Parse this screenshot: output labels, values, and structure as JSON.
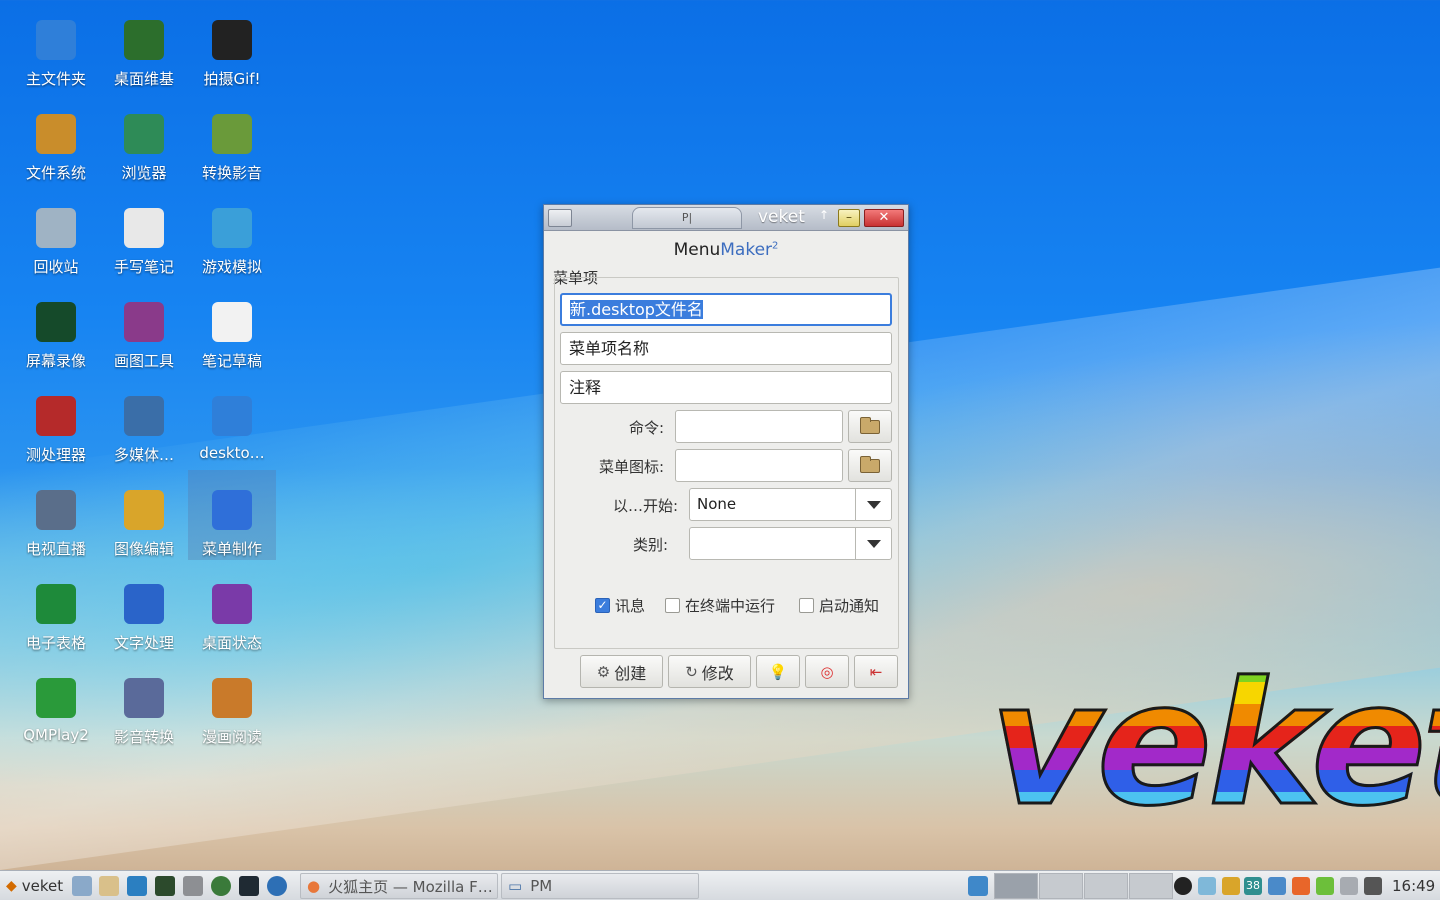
{
  "desktop": {
    "icons": [
      {
        "label": "主文件夹",
        "icon": "home-folder-icon"
      },
      {
        "label": "桌面维基",
        "icon": "wiki-icon"
      },
      {
        "label": "拍摄Gif!",
        "icon": "camera-icon"
      },
      {
        "label": "文件系统",
        "icon": "filesystem-icon"
      },
      {
        "label": "浏览器",
        "icon": "globe-icon"
      },
      {
        "label": "转换影音",
        "icon": "convert-media-icon"
      },
      {
        "label": "回收站",
        "icon": "trash-icon"
      },
      {
        "label": "手写笔记",
        "icon": "handwriting-icon"
      },
      {
        "label": "游戏模拟",
        "icon": "dolphin-icon"
      },
      {
        "label": "屏幕录像",
        "icon": "screen-record-icon"
      },
      {
        "label": "画图工具",
        "icon": "paint-icon"
      },
      {
        "label": "笔记草稿",
        "icon": "xournal-icon"
      },
      {
        "label": "测处理器",
        "icon": "cpu-test-icon"
      },
      {
        "label": "多媒体…",
        "icon": "multimedia-icon"
      },
      {
        "label": "deskto…",
        "icon": "folder-icon"
      },
      {
        "label": "电视直播",
        "icon": "tv-icon"
      },
      {
        "label": "图像编辑",
        "icon": "image-edit-icon"
      },
      {
        "label": "菜单制作",
        "icon": "translate-icon"
      },
      {
        "label": "电子表格",
        "icon": "spreadsheet-icon"
      },
      {
        "label": "文字处理",
        "icon": "word-icon"
      },
      {
        "label": "桌面状态",
        "icon": "monitor-icon"
      },
      {
        "label": "QMPlay2",
        "icon": "play-icon"
      },
      {
        "label": "影音转换",
        "icon": "video-convert-icon"
      },
      {
        "label": "漫画阅读",
        "icon": "monkey-icon"
      }
    ],
    "logo_text": "veket"
  },
  "window": {
    "title": "veket",
    "tab_text": "P|",
    "app_name_part1": "Menu",
    "app_name_part2": "Maker",
    "app_name_sup": "2",
    "group_label": "菜单项",
    "desktop_filename_value": "新.desktop文件名",
    "menu_item_name_value": "菜单项名称",
    "comment_value": "注释",
    "command_label": "命令:",
    "command_value": "",
    "menu_icon_label": "菜单图标:",
    "menu_icon_value": "",
    "start_with_label": "以…开始:",
    "start_with_value": "None",
    "category_label": "类别:",
    "category_value": "",
    "checkboxes": [
      {
        "label": "讯息",
        "checked": true
      },
      {
        "label": "在终端中运行",
        "checked": false
      },
      {
        "label": "启动通知",
        "checked": false
      }
    ],
    "buttons": {
      "create": "创建",
      "modify": "修改"
    }
  },
  "taskbar": {
    "start_label": "veket",
    "tasks": [
      {
        "label": "火狐主页 — Mozilla F…"
      },
      {
        "label": "PM"
      }
    ],
    "tray_badge": "38",
    "clock": "16:49"
  },
  "colors": {
    "accent": "#3b7ddd",
    "title_close": "#c83232",
    "title_min": "#e1cf62"
  }
}
